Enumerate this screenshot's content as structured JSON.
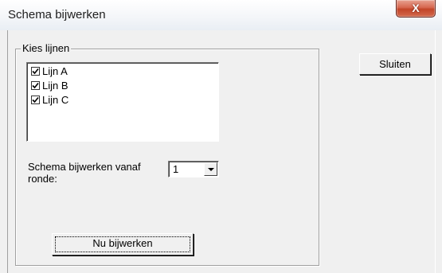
{
  "window": {
    "title": "Schema bijwerken",
    "close_glyph": "X"
  },
  "group": {
    "label": "Kies lijnen",
    "items": [
      {
        "label": "Lijn A",
        "checked": true
      },
      {
        "label": "Lijn B",
        "checked": true
      },
      {
        "label": "Lijn C",
        "checked": true
      }
    ]
  },
  "update_from": {
    "label": "Schema bijwerken vanaf ronde:",
    "selected": "1"
  },
  "buttons": {
    "close_label": "Sluiten",
    "update_label": "Nu bijwerken"
  },
  "icons": {
    "checkbox": "check-icon",
    "dropdown": "chevron-down-icon",
    "close": "close-icon"
  }
}
